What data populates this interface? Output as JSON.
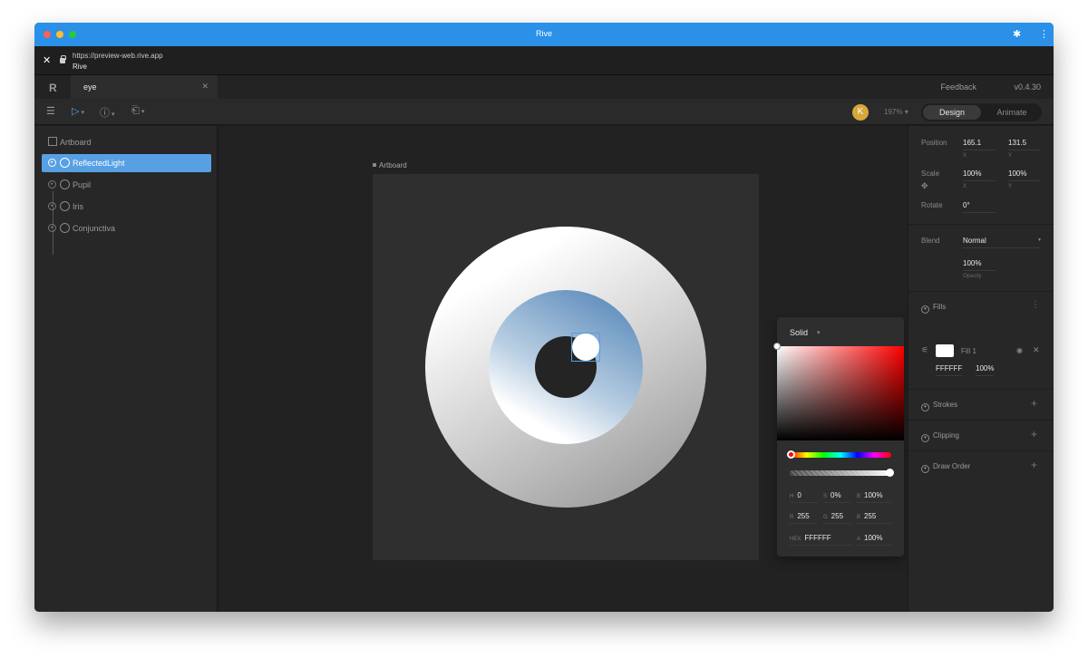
{
  "browser": {
    "title": "Rive",
    "url": "https://preview-web.rive.app",
    "page_title": "Rive",
    "dot_colors": [
      "#ff5f57",
      "#febc2e",
      "#28c840"
    ]
  },
  "tabs": {
    "active_tab": "eye",
    "feedback_label": "Feedback",
    "version": "v0.4.30"
  },
  "toolbar": {
    "avatar_initial": "K",
    "zoom": "197%",
    "mode_design": "Design",
    "mode_animate": "Animate"
  },
  "hierarchy": {
    "artboard": "Artboard",
    "items": [
      {
        "label": "ReflectedLight",
        "selected": true
      },
      {
        "label": "Pupil",
        "selected": false
      },
      {
        "label": "Iris",
        "selected": false
      },
      {
        "label": "Conjunctiva",
        "selected": false
      }
    ]
  },
  "stage": {
    "artboard_label": "Artboard"
  },
  "color_picker": {
    "type": "Solid",
    "h": "0",
    "s": "0%",
    "b": "100%",
    "r": "255",
    "g": "255",
    "b_rgb": "255",
    "hex": "FFFFFF",
    "a": "100%",
    "labels": {
      "h": "H",
      "s": "S",
      "b": "B",
      "r": "R",
      "g": "G",
      "b_rgb": "B",
      "hex": "HEX",
      "a": "A"
    }
  },
  "inspector": {
    "position_label": "Position",
    "position_x": "165.1",
    "position_y": "131.5",
    "scale_label": "Scale",
    "scale_x": "100%",
    "scale_y": "100%",
    "rotate_label": "Rotate",
    "rotate": "0°",
    "x_sub": "X",
    "y_sub": "Y",
    "blend_label": "Blend",
    "blend_value": "Normal",
    "opacity_value": "100%",
    "opacity_sub": "Opacity",
    "fills_label": "Fills",
    "fill_name": "Fill 1",
    "fill_hex": "FFFFFF",
    "fill_opacity": "100%",
    "strokes_label": "Strokes",
    "clipping_label": "Clipping",
    "draw_order_label": "Draw Order"
  },
  "colors": {
    "accent": "#57a0e3",
    "titlebar": "#2a90e8"
  }
}
